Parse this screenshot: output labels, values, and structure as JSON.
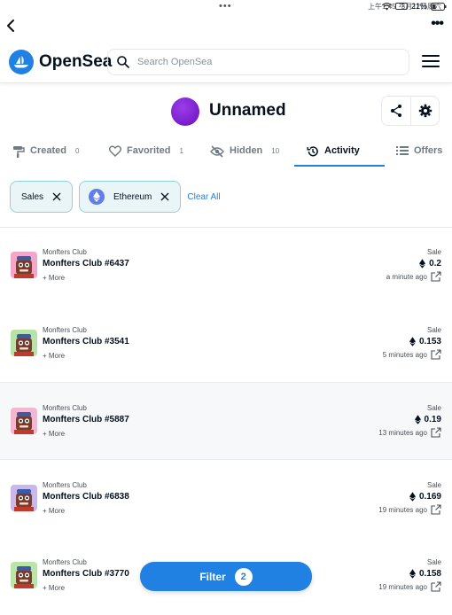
{
  "status_bar": {
    "time": "上午1:45",
    "date": "3月12日周六",
    "dots": "•••",
    "battery_label": "21%",
    "battery_pill": "21"
  },
  "nav": {
    "more": "•••"
  },
  "header": {
    "brand": "OpenSea",
    "search_placeholder": "Search OpenSea"
  },
  "profile": {
    "name": "Unnamed"
  },
  "tabs": [
    {
      "label": "Created",
      "count": "0"
    },
    {
      "label": "Favorited",
      "count": "1"
    },
    {
      "label": "Hidden",
      "count": "10"
    },
    {
      "label": "Activity",
      "count": ""
    },
    {
      "label": "Offers",
      "count": ""
    }
  ],
  "active_tab": "Activity",
  "filters": {
    "chips": [
      "Sales",
      "Ethereum"
    ],
    "clear_all": "Clear All"
  },
  "activity": [
    {
      "collection": "Monfters Club",
      "name": "Monfters Club #6437",
      "more": "+ More",
      "event": "Sale",
      "price": "0.2",
      "time": "a minute ago",
      "avatar_bg": "#f3a6c8"
    },
    {
      "collection": "Monfters Club",
      "name": "Monfters Club #3541",
      "more": "+ More",
      "event": "Sale",
      "price": "0.153",
      "time": "5 minutes ago",
      "avatar_bg": "#b7e3a8"
    },
    {
      "collection": "Monfters Club",
      "name": "Monfters Club #5887",
      "more": "+ More",
      "event": "Sale",
      "price": "0.19",
      "time": "13 minutes ago",
      "avatar_bg": "#f5b6d2"
    },
    {
      "collection": "Monfters Club",
      "name": "Monfters Club #6838",
      "more": "+ More",
      "event": "Sale",
      "price": "0.169",
      "time": "19 minutes ago",
      "avatar_bg": "#c9b8ec"
    },
    {
      "collection": "Monfters Club",
      "name": "Monfters Club #3770",
      "more": "+ More",
      "event": "Sale",
      "price": "0.158",
      "time": "19 minutes ago",
      "avatar_bg": "#b9e6a8"
    }
  ],
  "filter_button": {
    "label": "Filter",
    "count": "2"
  },
  "colors": {
    "accent": "#2081e2",
    "chip_border": "#8fd3d3",
    "chip_bg": "#eaf5f7"
  }
}
